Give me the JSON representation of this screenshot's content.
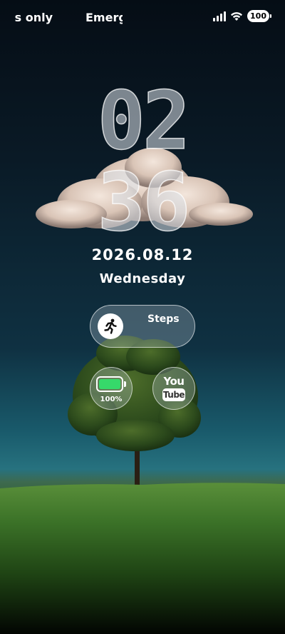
{
  "status_bar": {
    "carrier_left": "s only",
    "carrier_right": "Emerg",
    "battery_level": "100"
  },
  "clock": {
    "hour": "02",
    "minute": "36"
  },
  "date": {
    "date_text": "2026.08.12",
    "weekday": "Wednesday"
  },
  "widgets": {
    "steps_label": "Steps",
    "battery_percent": "100%",
    "battery_fill_fraction": 1.0,
    "youtube_top": "You",
    "youtube_bottom": "Tube"
  },
  "icons": {
    "steps": "running-person-icon",
    "battery": "battery-icon",
    "youtube": "youtube-icon",
    "signal": "signal-icon",
    "wifi": "wifi-icon"
  },
  "colors": {
    "battery_fill": "#36d96a",
    "grass": "#3f7a2c",
    "sky_top": "#050d15",
    "sky_horizon": "#27727f"
  }
}
